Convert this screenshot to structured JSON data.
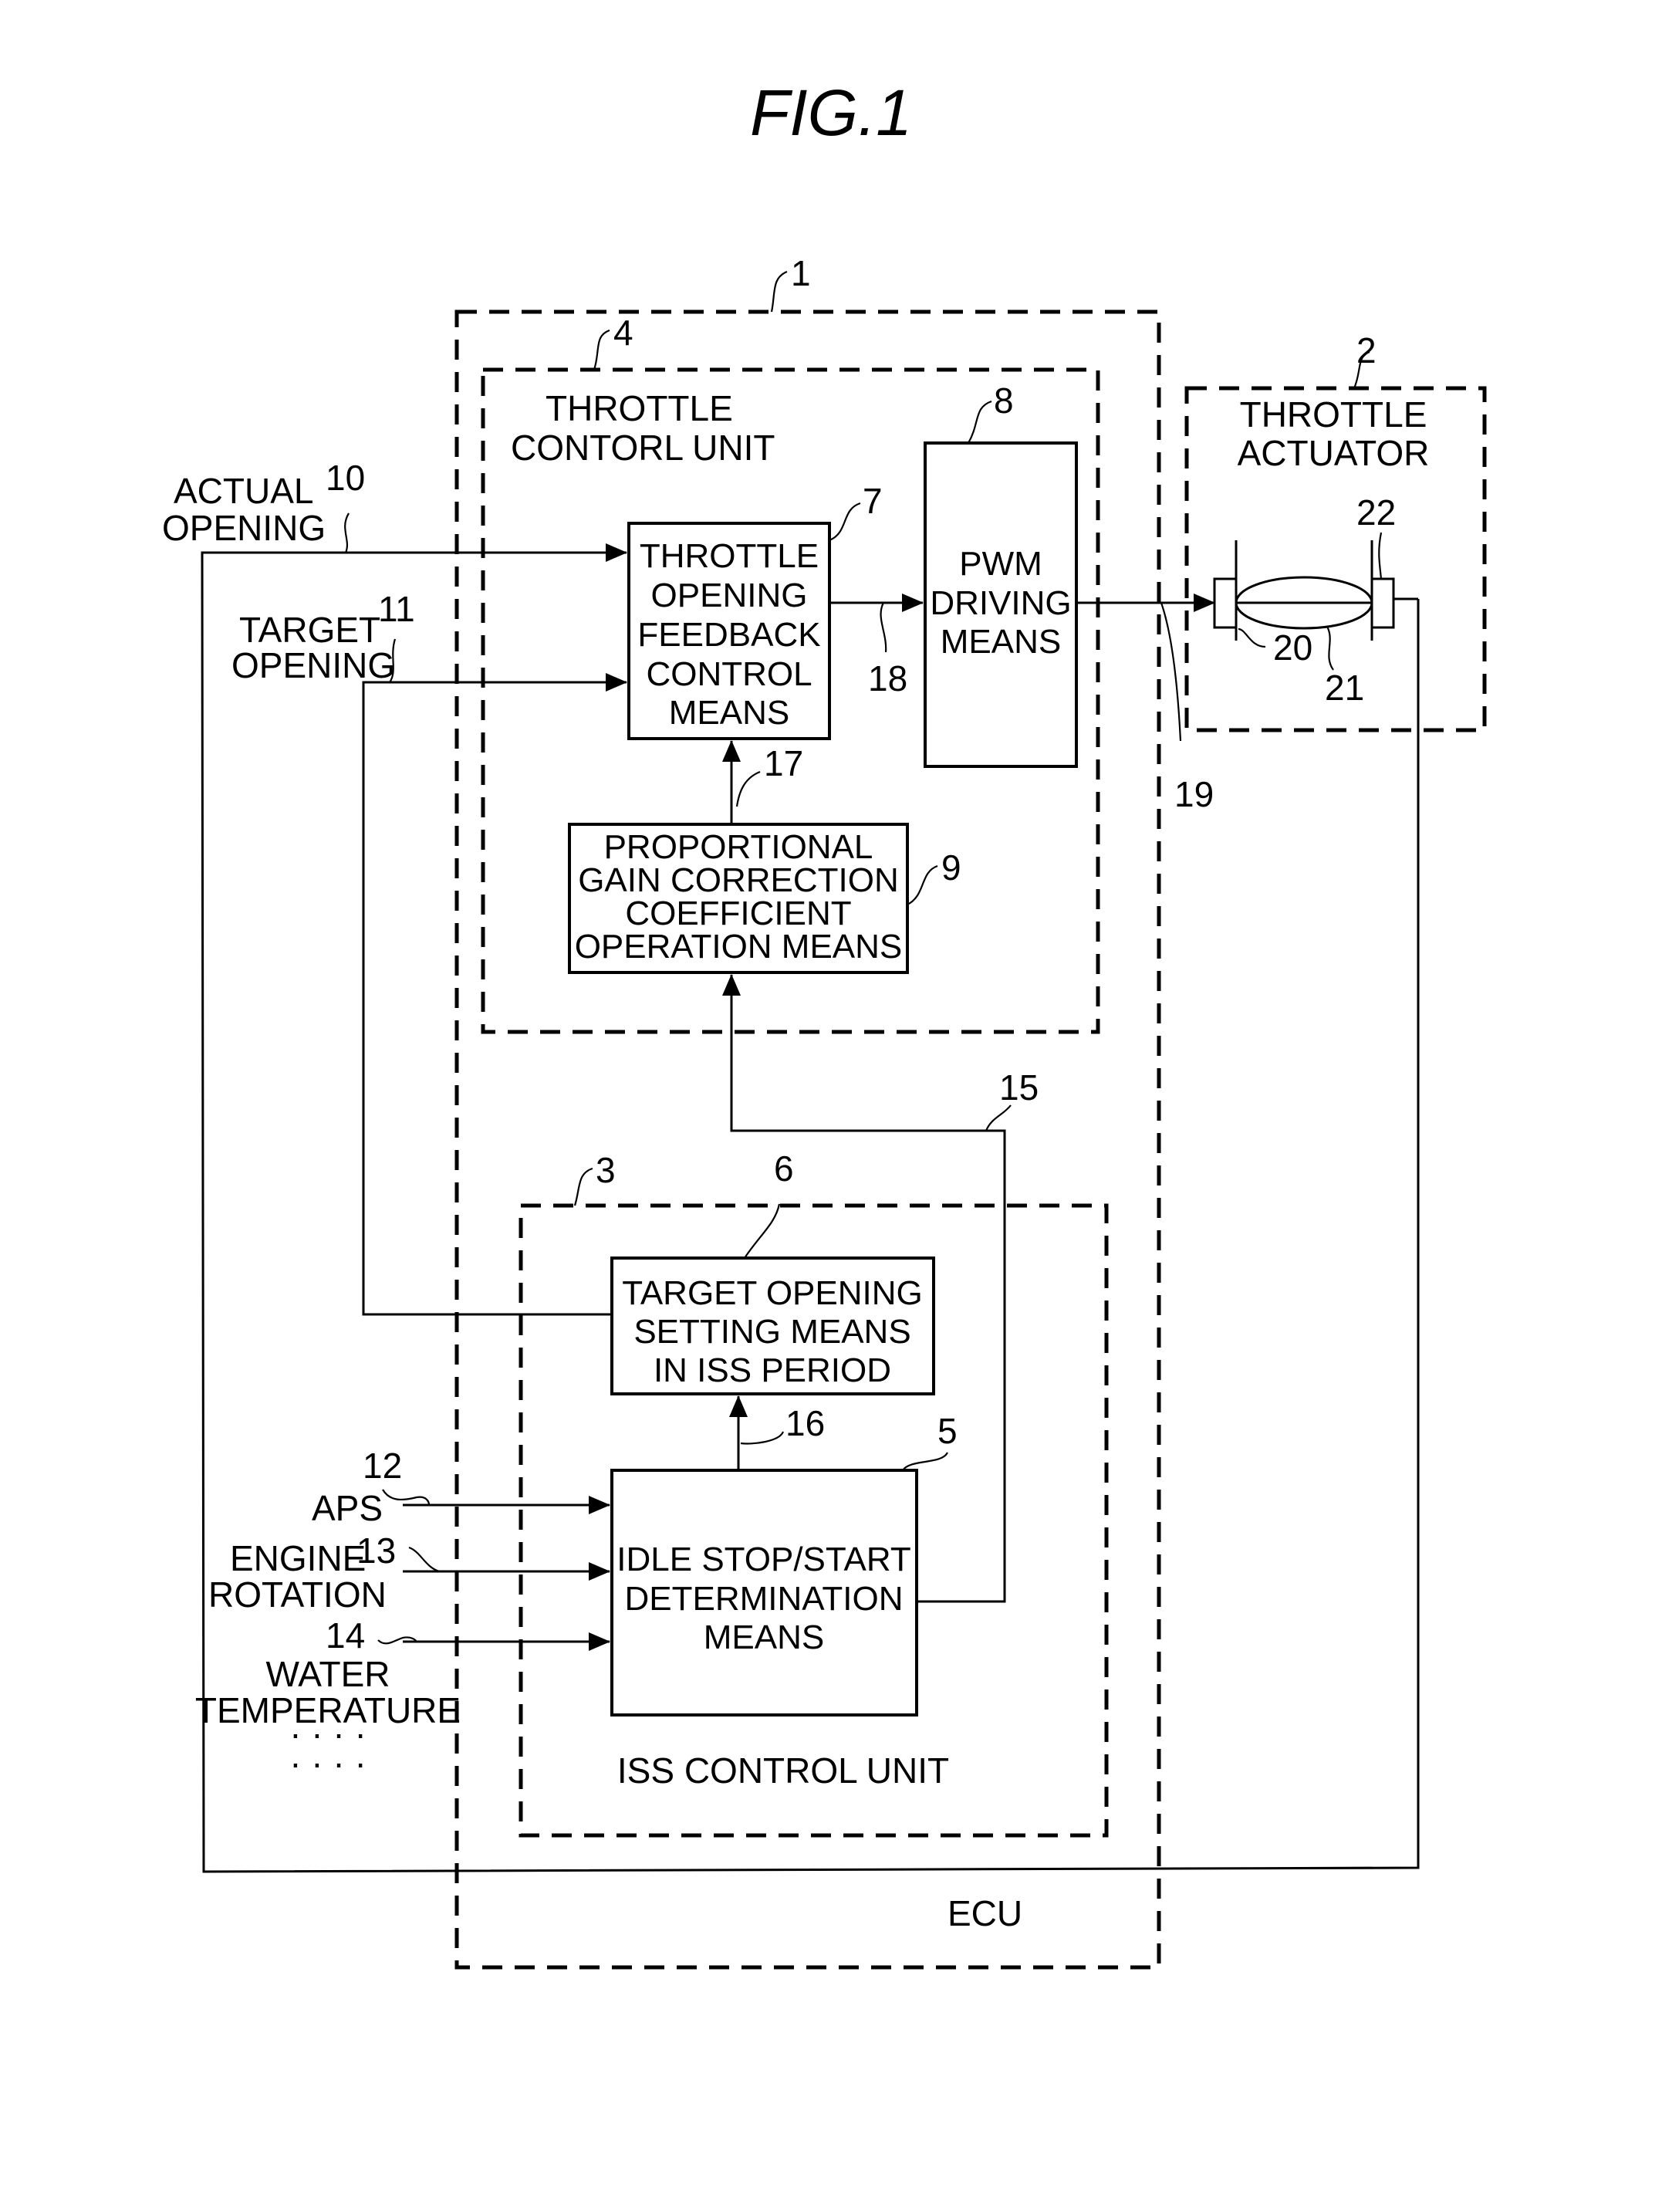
{
  "figure": {
    "title": "FIG.1"
  },
  "containers": {
    "ecu": {
      "ref": "1",
      "label": "ECU"
    },
    "throttle_control_unit": {
      "ref": "4",
      "label_lines": [
        "THROTTLE",
        "CONTORL UNIT"
      ]
    },
    "throttle_actuator": {
      "ref": "2",
      "label_lines": [
        "THROTTLE",
        "ACTUATOR"
      ]
    },
    "iss_control_unit": {
      "ref": "3",
      "label": "ISS CONTROL UNIT"
    }
  },
  "blocks": {
    "feedback_control": {
      "ref": "7",
      "lines": [
        "THROTTLE",
        "OPENING",
        "FEEDBACK",
        "CONTROL",
        "MEANS"
      ]
    },
    "pwm_driving": {
      "ref": "8",
      "lines": [
        "PWM",
        "DRIVING",
        "MEANS"
      ]
    },
    "gain_correction": {
      "ref": "9",
      "lines": [
        "PROPORTIONAL",
        "GAIN CORRECTION",
        "COEFFICIENT",
        "OPERATION MEANS"
      ]
    },
    "target_opening_setting": {
      "ref": "6",
      "lines": [
        "TARGET OPENING",
        "SETTING MEANS",
        "IN ISS PERIOD"
      ]
    },
    "idle_stop_start": {
      "ref": "5",
      "lines": [
        "IDLE STOP/START",
        "DETERMINATION",
        "MEANS"
      ]
    }
  },
  "signals": {
    "actual_opening": {
      "ref": "10",
      "lines": [
        "ACTUAL",
        "OPENING"
      ]
    },
    "target_opening": {
      "ref": "11",
      "lines": [
        "TARGET",
        "OPENING"
      ]
    },
    "aps": {
      "ref": "12",
      "label": "APS"
    },
    "engine_rotation": {
      "ref": "13",
      "lines": [
        "ENGINE",
        "ROTATION"
      ]
    },
    "water_temperature": {
      "ref": "14",
      "lines": [
        "WATER",
        "TEMPERATURE"
      ]
    },
    "more_inputs": [
      "· · · ·",
      "· · · ·"
    ],
    "iss_to_gain": {
      "ref": "15"
    },
    "iss_to_target": {
      "ref": "16"
    },
    "gain_to_feedback": {
      "ref": "17"
    },
    "feedback_to_pwm": {
      "ref": "18"
    },
    "pwm_to_actuator": {
      "ref": "19"
    }
  },
  "actuator_parts": {
    "motor_left": {
      "ref": "20"
    },
    "valve": {
      "ref": "21"
    },
    "sensor_right": {
      "ref": "22"
    }
  }
}
